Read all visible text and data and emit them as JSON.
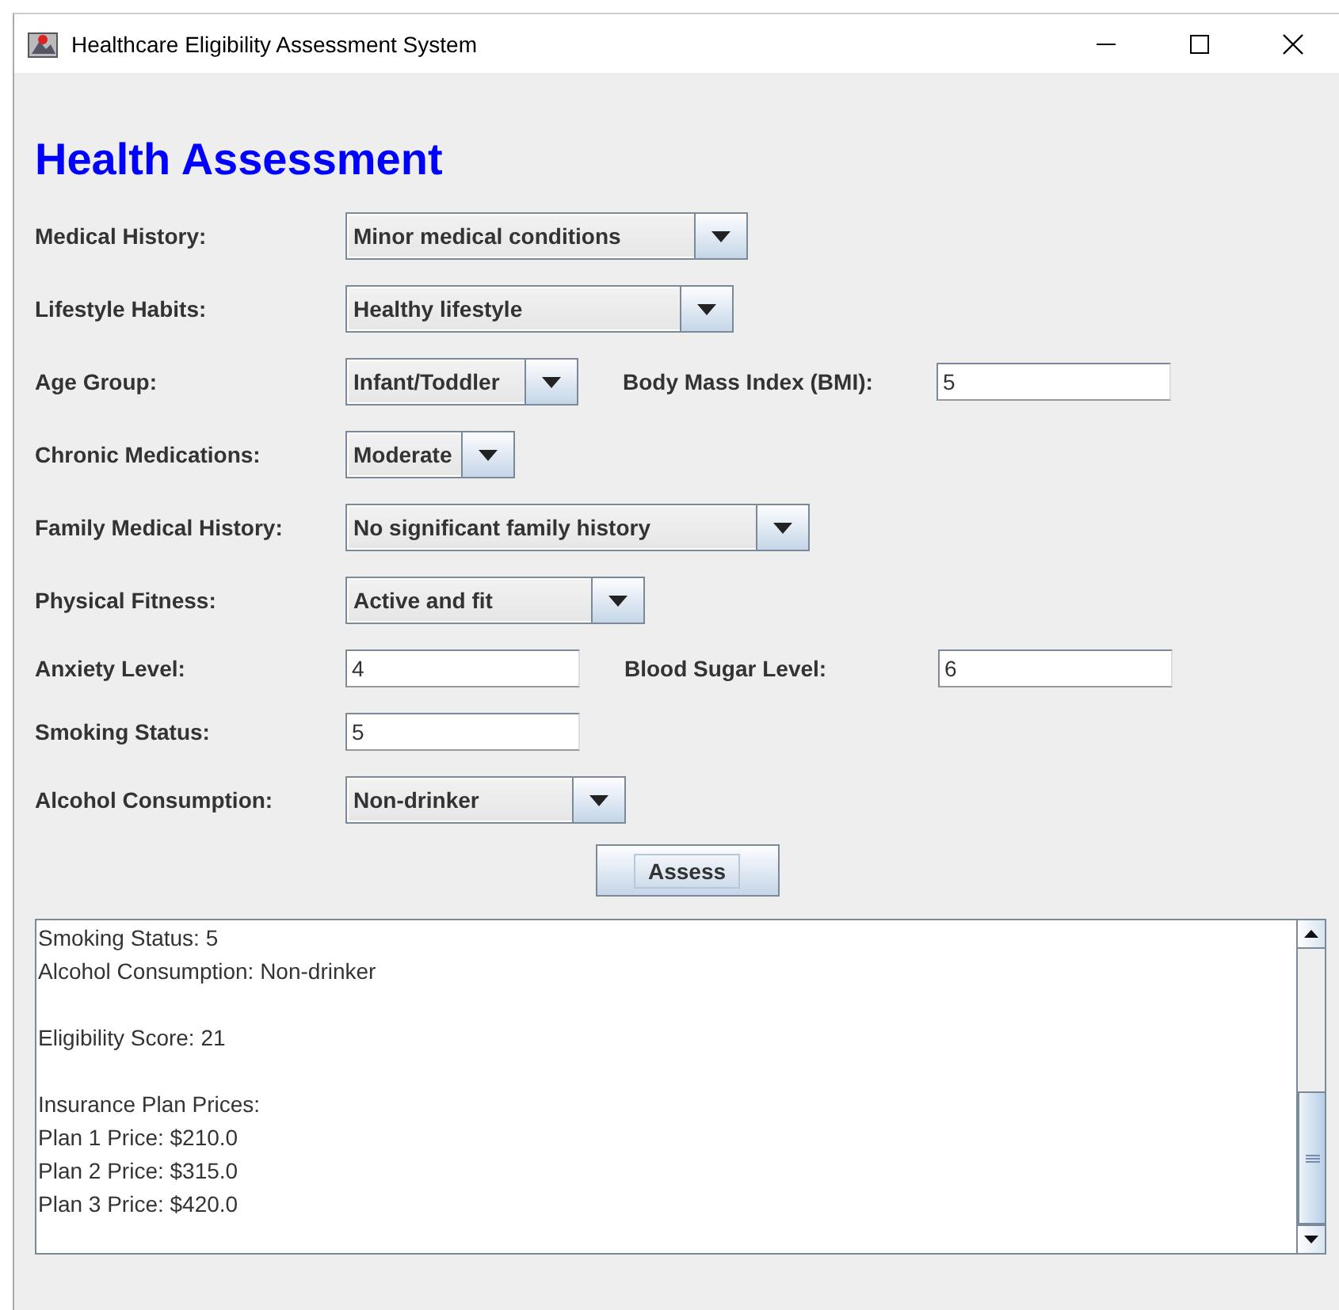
{
  "window": {
    "title": "Healthcare Eligibility Assessment System"
  },
  "heading": "Health Assessment",
  "fields": [
    {
      "label": "Medical History:",
      "kind": "combo",
      "value": "Minor medical conditions"
    },
    {
      "label": "Lifestyle Habits:",
      "kind": "combo",
      "value": "Healthy lifestyle"
    },
    {
      "label": "Age Group:",
      "kind": "combo",
      "value": "Infant/Toddler",
      "paired": {
        "label": "Body Mass Index (BMI):",
        "value": "5"
      }
    },
    {
      "label": "Chronic Medications:",
      "kind": "combo",
      "value": "Moderate"
    },
    {
      "label": "Family Medical History:",
      "kind": "combo",
      "value": "No significant family history"
    },
    {
      "label": "Physical Fitness:",
      "kind": "combo",
      "value": "Active and fit"
    },
    {
      "label": "Anxiety Level:",
      "kind": "text",
      "value": "4",
      "paired": {
        "label": "Blood Sugar Level:",
        "value": "6"
      }
    },
    {
      "label": "Smoking Status:",
      "kind": "text",
      "value": "5"
    },
    {
      "label": "Alcohol Consumption:",
      "kind": "combo",
      "value": "Non-drinker"
    }
  ],
  "assess_button": "Assess",
  "output": {
    "paragraphs": [
      [
        "Smoking Status: 5",
        "Alcohol Consumption: Non-drinker"
      ],
      [
        "Eligibility Score: 21"
      ],
      [
        "Insurance Plan Prices:",
        "Plan 1 Price: $210.0",
        "Plan 2 Price: $315.0",
        "Plan 3 Price: $420.0"
      ]
    ]
  }
}
